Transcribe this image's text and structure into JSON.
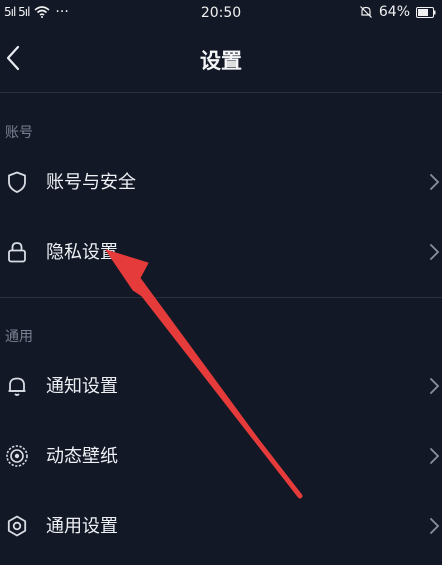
{
  "status_bar": {
    "signal_text": "5ıl 5ıl",
    "more_dots": "···",
    "time": "20:50",
    "battery": "64%"
  },
  "header": {
    "title": "设置"
  },
  "sections": [
    {
      "label": "账号",
      "items": [
        {
          "label": "账号与安全",
          "icon": "shield-icon"
        },
        {
          "label": "隐私设置",
          "icon": "lock-icon"
        }
      ]
    },
    {
      "label": "通用",
      "items": [
        {
          "label": "通知设置",
          "icon": "bell-icon"
        },
        {
          "label": "动态壁纸",
          "icon": "wallpaper-icon"
        },
        {
          "label": "通用设置",
          "icon": "gear-icon"
        }
      ]
    }
  ],
  "colors": {
    "background": "#121826",
    "text": "#eef0f4",
    "muted": "#7a8191",
    "annotation_arrow": "#e63b3b"
  }
}
